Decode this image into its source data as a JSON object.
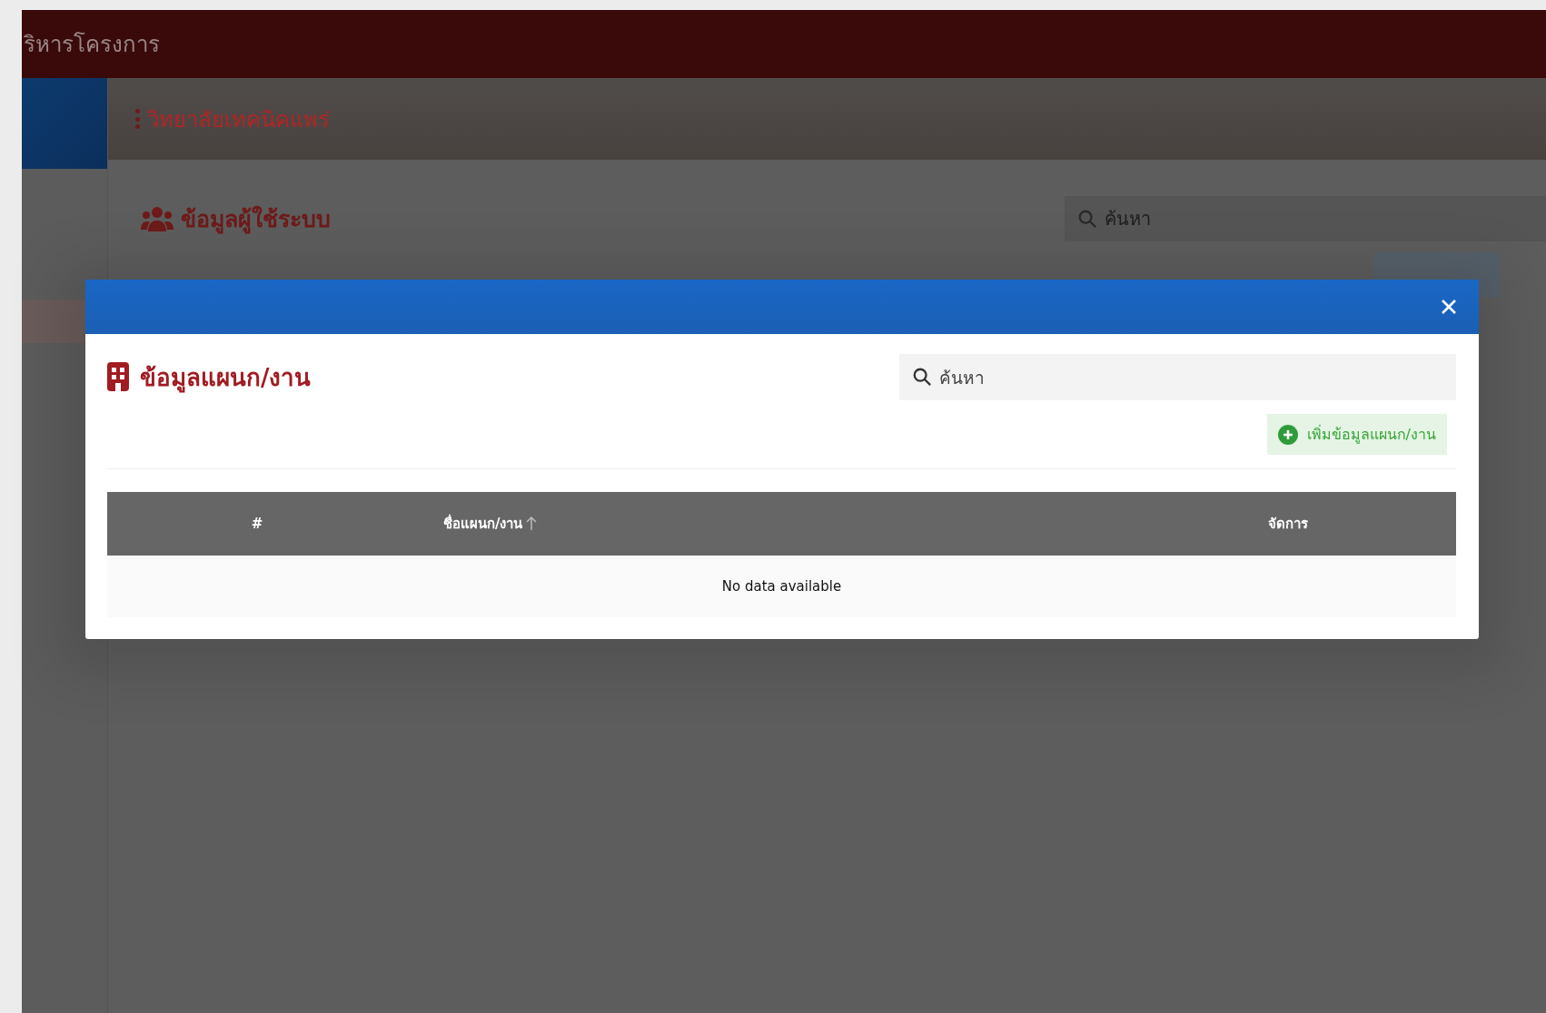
{
  "page": {
    "app_title": "ริหารโครงการ",
    "college": "วิทยาลัยเทคนิคแพร่",
    "section_title": "ข้อมูลผู้ใช้ระบบ",
    "search": {
      "placeholder": "ค้นหา"
    }
  },
  "modal": {
    "title": "ข้อมูลแผนก/งาน",
    "search": {
      "placeholder": "ค้นหา"
    },
    "add_button": "เพิ่มข้อมูลแผนก/งาน",
    "table": {
      "columns": [
        {
          "label": "#",
          "sorted_ascending": false
        },
        {
          "label": "ชื่อแผนก/งาน",
          "sorted_ascending": true
        },
        {
          "label": "จัดการ",
          "sorted_ascending": false
        }
      ],
      "empty_text": "No data available"
    }
  }
}
